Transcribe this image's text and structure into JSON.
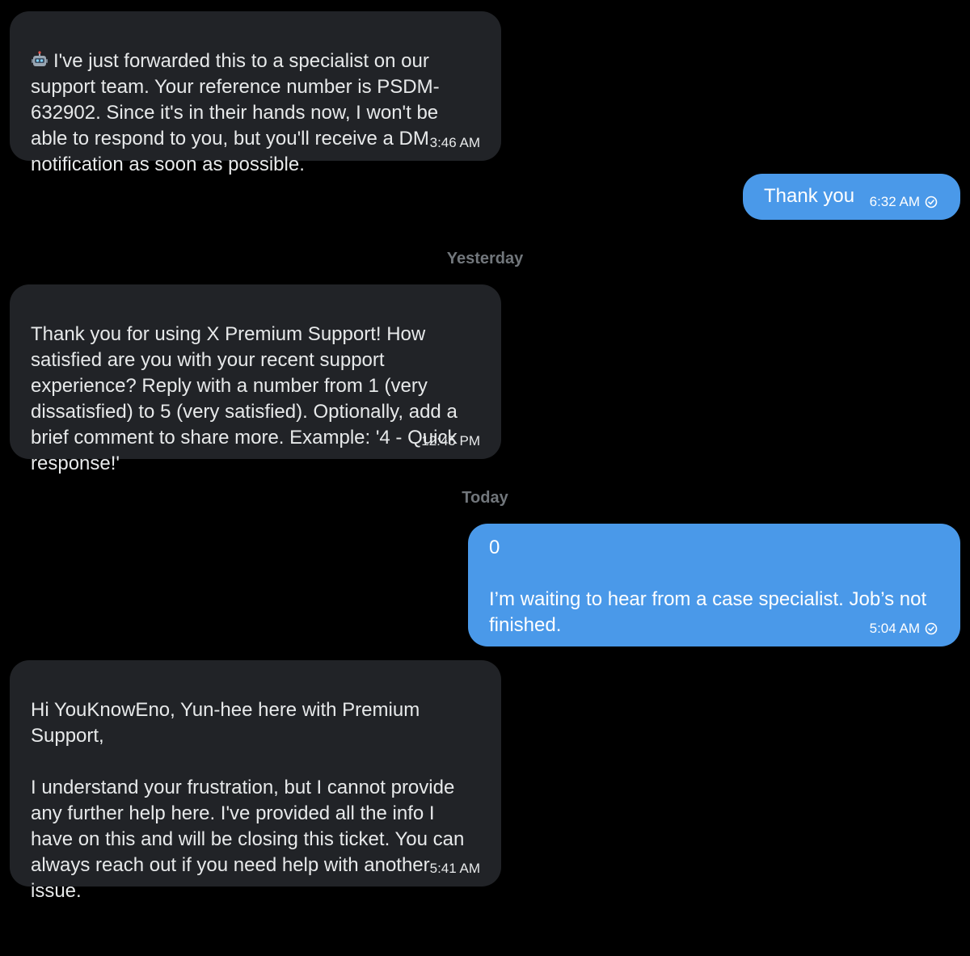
{
  "messages": [
    {
      "sender": "support",
      "icon": "robot-icon",
      "text": "I've just forwarded this to a specialist on our support team. Your reference number is PSDM-632902. Since it's in their hands now, I won't be able to respond to you, but you'll receive a DM notification as soon as possible.",
      "time": "3:46 AM"
    },
    {
      "sender": "me",
      "text": "Thank you",
      "time": "6:32 AM",
      "status_icon": "read-check-icon"
    },
    {
      "sender": "support",
      "text": "Thank you for using X Premium Support! How satisfied are you with your recent support experience? Reply with a number from 1 (very dissatisfied) to 5 (very satisfied). Optionally, add a brief comment to share more. Example: '4 - Quick response!'",
      "time": "12:45 PM"
    },
    {
      "sender": "me",
      "text": "0\n\nI’m waiting to hear from a case specialist. Job’s not finished.",
      "time": "5:04 AM",
      "status_icon": "read-check-icon"
    },
    {
      "sender": "support",
      "text": "Hi YouKnowEno, Yun-hee here with Premium Support,\n\nI understand your frustration, but I cannot provide any further help here. I've provided all the info I have on this and will be closing this ticket. You can always reach out if you need help with another issue.",
      "time": "5:41 AM"
    }
  ],
  "dividers": {
    "yesterday": "Yesterday",
    "today": "Today"
  },
  "colors": {
    "background": "#000000",
    "incoming_bubble": "#212327",
    "outgoing_bubble": "#4a99e9",
    "divider_text": "#71767b"
  }
}
